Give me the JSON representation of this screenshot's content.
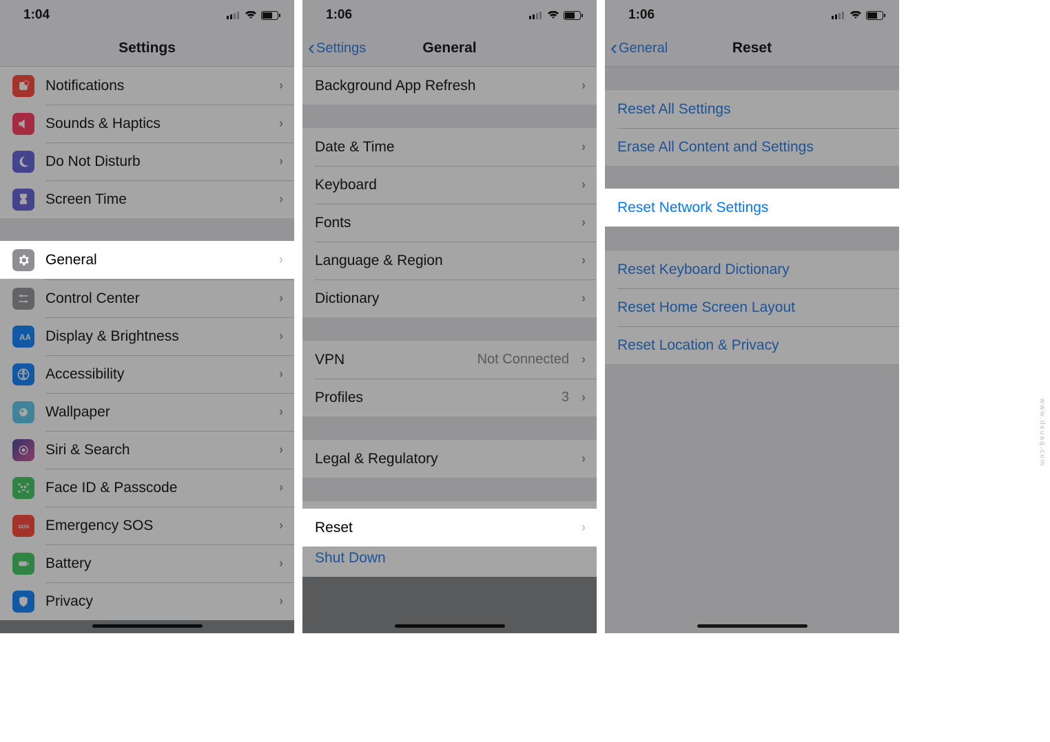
{
  "panel1": {
    "time": "1:04",
    "title": "Settings",
    "items": [
      {
        "label": "Notifications",
        "icon": "notifications",
        "color": "#ff3b30"
      },
      {
        "label": "Sounds & Haptics",
        "icon": "sounds",
        "color": "#ff2d55"
      },
      {
        "label": "Do Not Disturb",
        "icon": "dnd",
        "color": "#5856d6"
      },
      {
        "label": "Screen Time",
        "icon": "screentime",
        "color": "#5856d6"
      }
    ],
    "group2": [
      {
        "label": "General",
        "icon": "general",
        "color": "#8e8e93",
        "highlight": true
      },
      {
        "label": "Control Center",
        "icon": "controlcenter",
        "color": "#8e8e93"
      },
      {
        "label": "Display & Brightness",
        "icon": "display",
        "color": "#007aff"
      },
      {
        "label": "Accessibility",
        "icon": "accessibility",
        "color": "#007aff"
      },
      {
        "label": "Wallpaper",
        "icon": "wallpaper",
        "color": "#54c7ec"
      },
      {
        "label": "Siri & Search",
        "icon": "siri",
        "color": "#1c1c1e"
      },
      {
        "label": "Face ID & Passcode",
        "icon": "faceid",
        "color": "#34c759"
      },
      {
        "label": "Emergency SOS",
        "icon": "sos",
        "color": "#ff3b30"
      },
      {
        "label": "Battery",
        "icon": "battery",
        "color": "#34c759"
      },
      {
        "label": "Privacy",
        "icon": "privacy",
        "color": "#007aff"
      }
    ]
  },
  "panel2": {
    "time": "1:06",
    "back": "Settings",
    "title": "General",
    "g1": [
      {
        "label": "Background App Refresh"
      }
    ],
    "g2": [
      {
        "label": "Date & Time"
      },
      {
        "label": "Keyboard"
      },
      {
        "label": "Fonts"
      },
      {
        "label": "Language & Region"
      },
      {
        "label": "Dictionary"
      }
    ],
    "g3": [
      {
        "label": "VPN",
        "detail": "Not Connected"
      },
      {
        "label": "Profiles",
        "detail": "3"
      }
    ],
    "g4": [
      {
        "label": "Legal & Regulatory"
      }
    ],
    "g5": [
      {
        "label": "Reset",
        "highlight": true
      },
      {
        "label": "Shut Down",
        "link": true
      }
    ]
  },
  "panel3": {
    "time": "1:06",
    "back": "General",
    "title": "Reset",
    "g1": [
      {
        "label": "Reset All Settings"
      },
      {
        "label": "Erase All Content and Settings"
      }
    ],
    "g2": [
      {
        "label": "Reset Network Settings",
        "highlight": true
      }
    ],
    "g3": [
      {
        "label": "Reset Keyboard Dictionary"
      },
      {
        "label": "Reset Home Screen Layout"
      },
      {
        "label": "Reset Location & Privacy"
      }
    ]
  },
  "watermark": "www.deuaq.com"
}
